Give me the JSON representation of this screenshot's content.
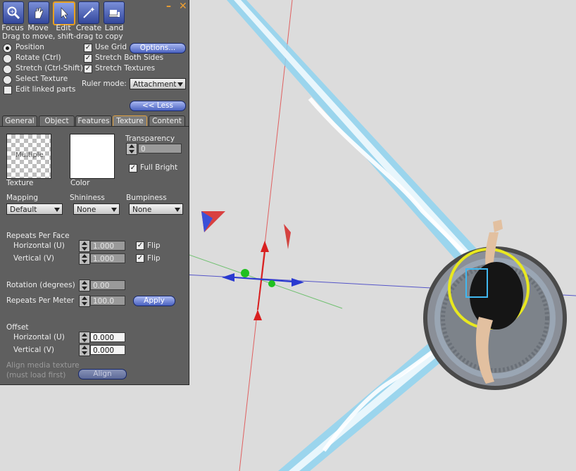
{
  "toolbar": {
    "tools": [
      {
        "label": "Focus",
        "icon": "magnifier-icon"
      },
      {
        "label": "Move",
        "icon": "hand-icon"
      },
      {
        "label": "Edit",
        "icon": "pointer-icon"
      },
      {
        "label": "Create",
        "icon": "wand-icon"
      },
      {
        "label": "Land",
        "icon": "bulldozer-icon"
      }
    ],
    "active_tool": "Edit",
    "minimize_label": "–",
    "close_label": "✕"
  },
  "hint": "Drag to move, shift-drag to copy",
  "modes": [
    {
      "label": "Position",
      "selected": true
    },
    {
      "label": "Rotate (Ctrl)",
      "selected": false
    },
    {
      "label": "Stretch (Ctrl-Shift)",
      "selected": false
    },
    {
      "label": "Select Texture",
      "selected": false
    }
  ],
  "edit_linked": {
    "label": "Edit linked parts",
    "checked": false
  },
  "grid_options": [
    {
      "label": "Use Grid",
      "checked": true
    },
    {
      "label": "Stretch Both Sides",
      "checked": true
    },
    {
      "label": "Stretch Textures",
      "checked": true
    }
  ],
  "options_button": "Options...",
  "ruler": {
    "label": "Ruler mode:",
    "value": "Attachment"
  },
  "less_button": "<< Less",
  "tabs": [
    "General",
    "Object",
    "Features",
    "Texture",
    "Content"
  ],
  "selected_tab": "Texture",
  "texture": {
    "texture_label": "Texture",
    "texture_overlay": "Multiple",
    "color_label": "Color",
    "transparency_label": "Transparency",
    "transparency_value": "0",
    "full_bright": {
      "label": "Full Bright",
      "checked": true
    },
    "mapping_label": "Mapping",
    "mapping_value": "Default",
    "shininess_label": "Shininess",
    "shininess_value": "None",
    "bumpiness_label": "Bumpiness",
    "bumpiness_value": "None",
    "repeats_label": "Repeats Per Face",
    "horizontal_u_label": "Horizontal (U)",
    "horizontal_u_value": "1.000",
    "vertical_v_label": "Vertical (V)",
    "vertical_v_value": "1.000",
    "flip_label": "Flip",
    "flip_u_checked": true,
    "flip_v_checked": true,
    "rotation_label": "Rotation (degrees)",
    "rotation_value": "0.00",
    "repeats_meter_label": "Repeats Per Meter",
    "repeats_meter_value": "100.0",
    "apply_button": "Apply",
    "offset_label": "Offset",
    "offset_u_label": "Horizontal (U)",
    "offset_u_value": "0.000",
    "offset_v_label": "Vertical (V)",
    "offset_v_value": "0.000",
    "align_media_line1": "Align media texture",
    "align_media_line2": "(must load first)",
    "align_button": "Align"
  },
  "colors": {
    "panel_bg": "#5f5f5f",
    "button_blue": "#4a62c0",
    "selection_highlight": "#e8a020",
    "beam": "#6fc8ea"
  }
}
